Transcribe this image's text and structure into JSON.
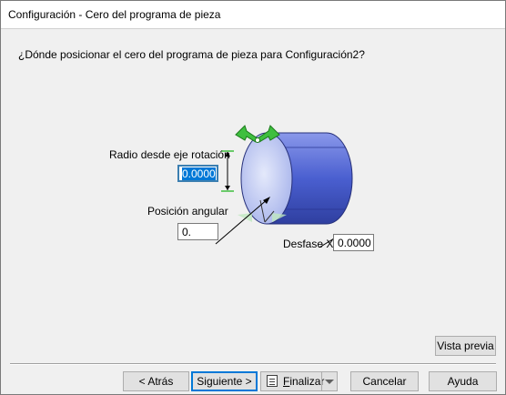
{
  "window": {
    "title": "Configuración - Cero del programa de pieza"
  },
  "question": "¿Dónde posicionar el cero del programa de pieza para Configuración2?",
  "fields": {
    "radius": {
      "label": "Radio desde eje rotación",
      "value": "0.0000"
    },
    "angle": {
      "label": "Posición angular",
      "value": "0."
    },
    "offset_x": {
      "label": "Desfase X",
      "value": "0.0000"
    }
  },
  "buttons": {
    "preview": "Vista previa",
    "back": "< Atrás",
    "next": "Siguiente >",
    "finish_prefix": "F",
    "finish_rest": "inalizar",
    "cancel": "Cancelar",
    "help": "Ayuda"
  },
  "colors": {
    "cylinder_body": "#4a5fd0",
    "cylinder_face": "#c8d2f5",
    "arrow_green": "#3fbf3f",
    "selection_blue": "#0078d7"
  }
}
